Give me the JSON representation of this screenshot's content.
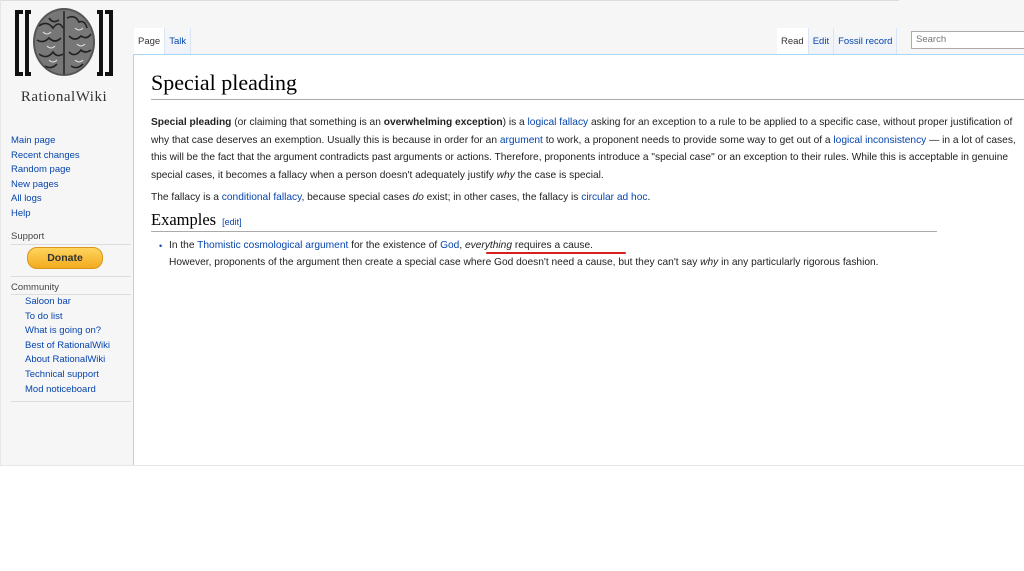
{
  "logo": {
    "text": "RationalWiki",
    "icon": "brain-logo-icon"
  },
  "sidebar": {
    "nav": [
      "Main page",
      "Recent changes",
      "Random page",
      "New pages",
      "All logs",
      "Help"
    ],
    "support_heading": "Support",
    "donate_label": "Donate",
    "community_heading": "Community",
    "community": [
      "Saloon bar",
      "To do list",
      "What is going on?",
      "Best of RationalWiki",
      "About RationalWiki",
      "Technical support",
      "Mod noticeboard"
    ]
  },
  "tabs": {
    "page": "Page",
    "talk": "Talk",
    "read": "Read",
    "edit": "Edit",
    "history": "Fossil record"
  },
  "search": {
    "placeholder": "Search"
  },
  "article": {
    "title": "Special pleading",
    "p1": {
      "t1": "Special pleading",
      "t2": " (or claiming that something is an ",
      "t3": "overwhelming exception",
      "t4": ") is a ",
      "l1": "logical fallacy",
      "t5": " asking for an exception to a rule to be applied to a specific case, without proper justification of why that case deserves an exemption. Usually this is because in order for an ",
      "l2": "argument",
      "t6": " to work, a proponent needs to provide some way to get out of a ",
      "l3": "logical inconsistency",
      "t7": " — in a lot of cases, this will be the fact that the argument contradicts past arguments or actions. Therefore, proponents introduce a \"special case\" or an exception to their rules. While this is acceptable in genuine special cases, it becomes a fallacy when a person doesn't adequately justify ",
      "t8": "why",
      "t9": " the case is special."
    },
    "p2": {
      "t1": "The fallacy is a ",
      "l1": "conditional fallacy",
      "t2": ", because special cases ",
      "t3": "do",
      "t4": " exist; in other cases, the fallacy is ",
      "l2": "circular ad hoc",
      "t5": "."
    },
    "section": {
      "heading": "Examples",
      "edit": "[edit]"
    },
    "example": {
      "t1": "In the ",
      "l1": "Thomistic cosmological argument",
      "t2": " for the existence of ",
      "l2": "God",
      "t3": ", ",
      "t4": "everything",
      "t5": " requires a cause.",
      "t6": "However, proponents of the argument then create a special case where God doesn't need a cause, but they can't say ",
      "t7": "why",
      "t8": " in any particularly rigorous fashion."
    }
  },
  "colors": {
    "link": "#0645ad",
    "annotation": "#d62020",
    "donate": "#f2ab1e"
  }
}
